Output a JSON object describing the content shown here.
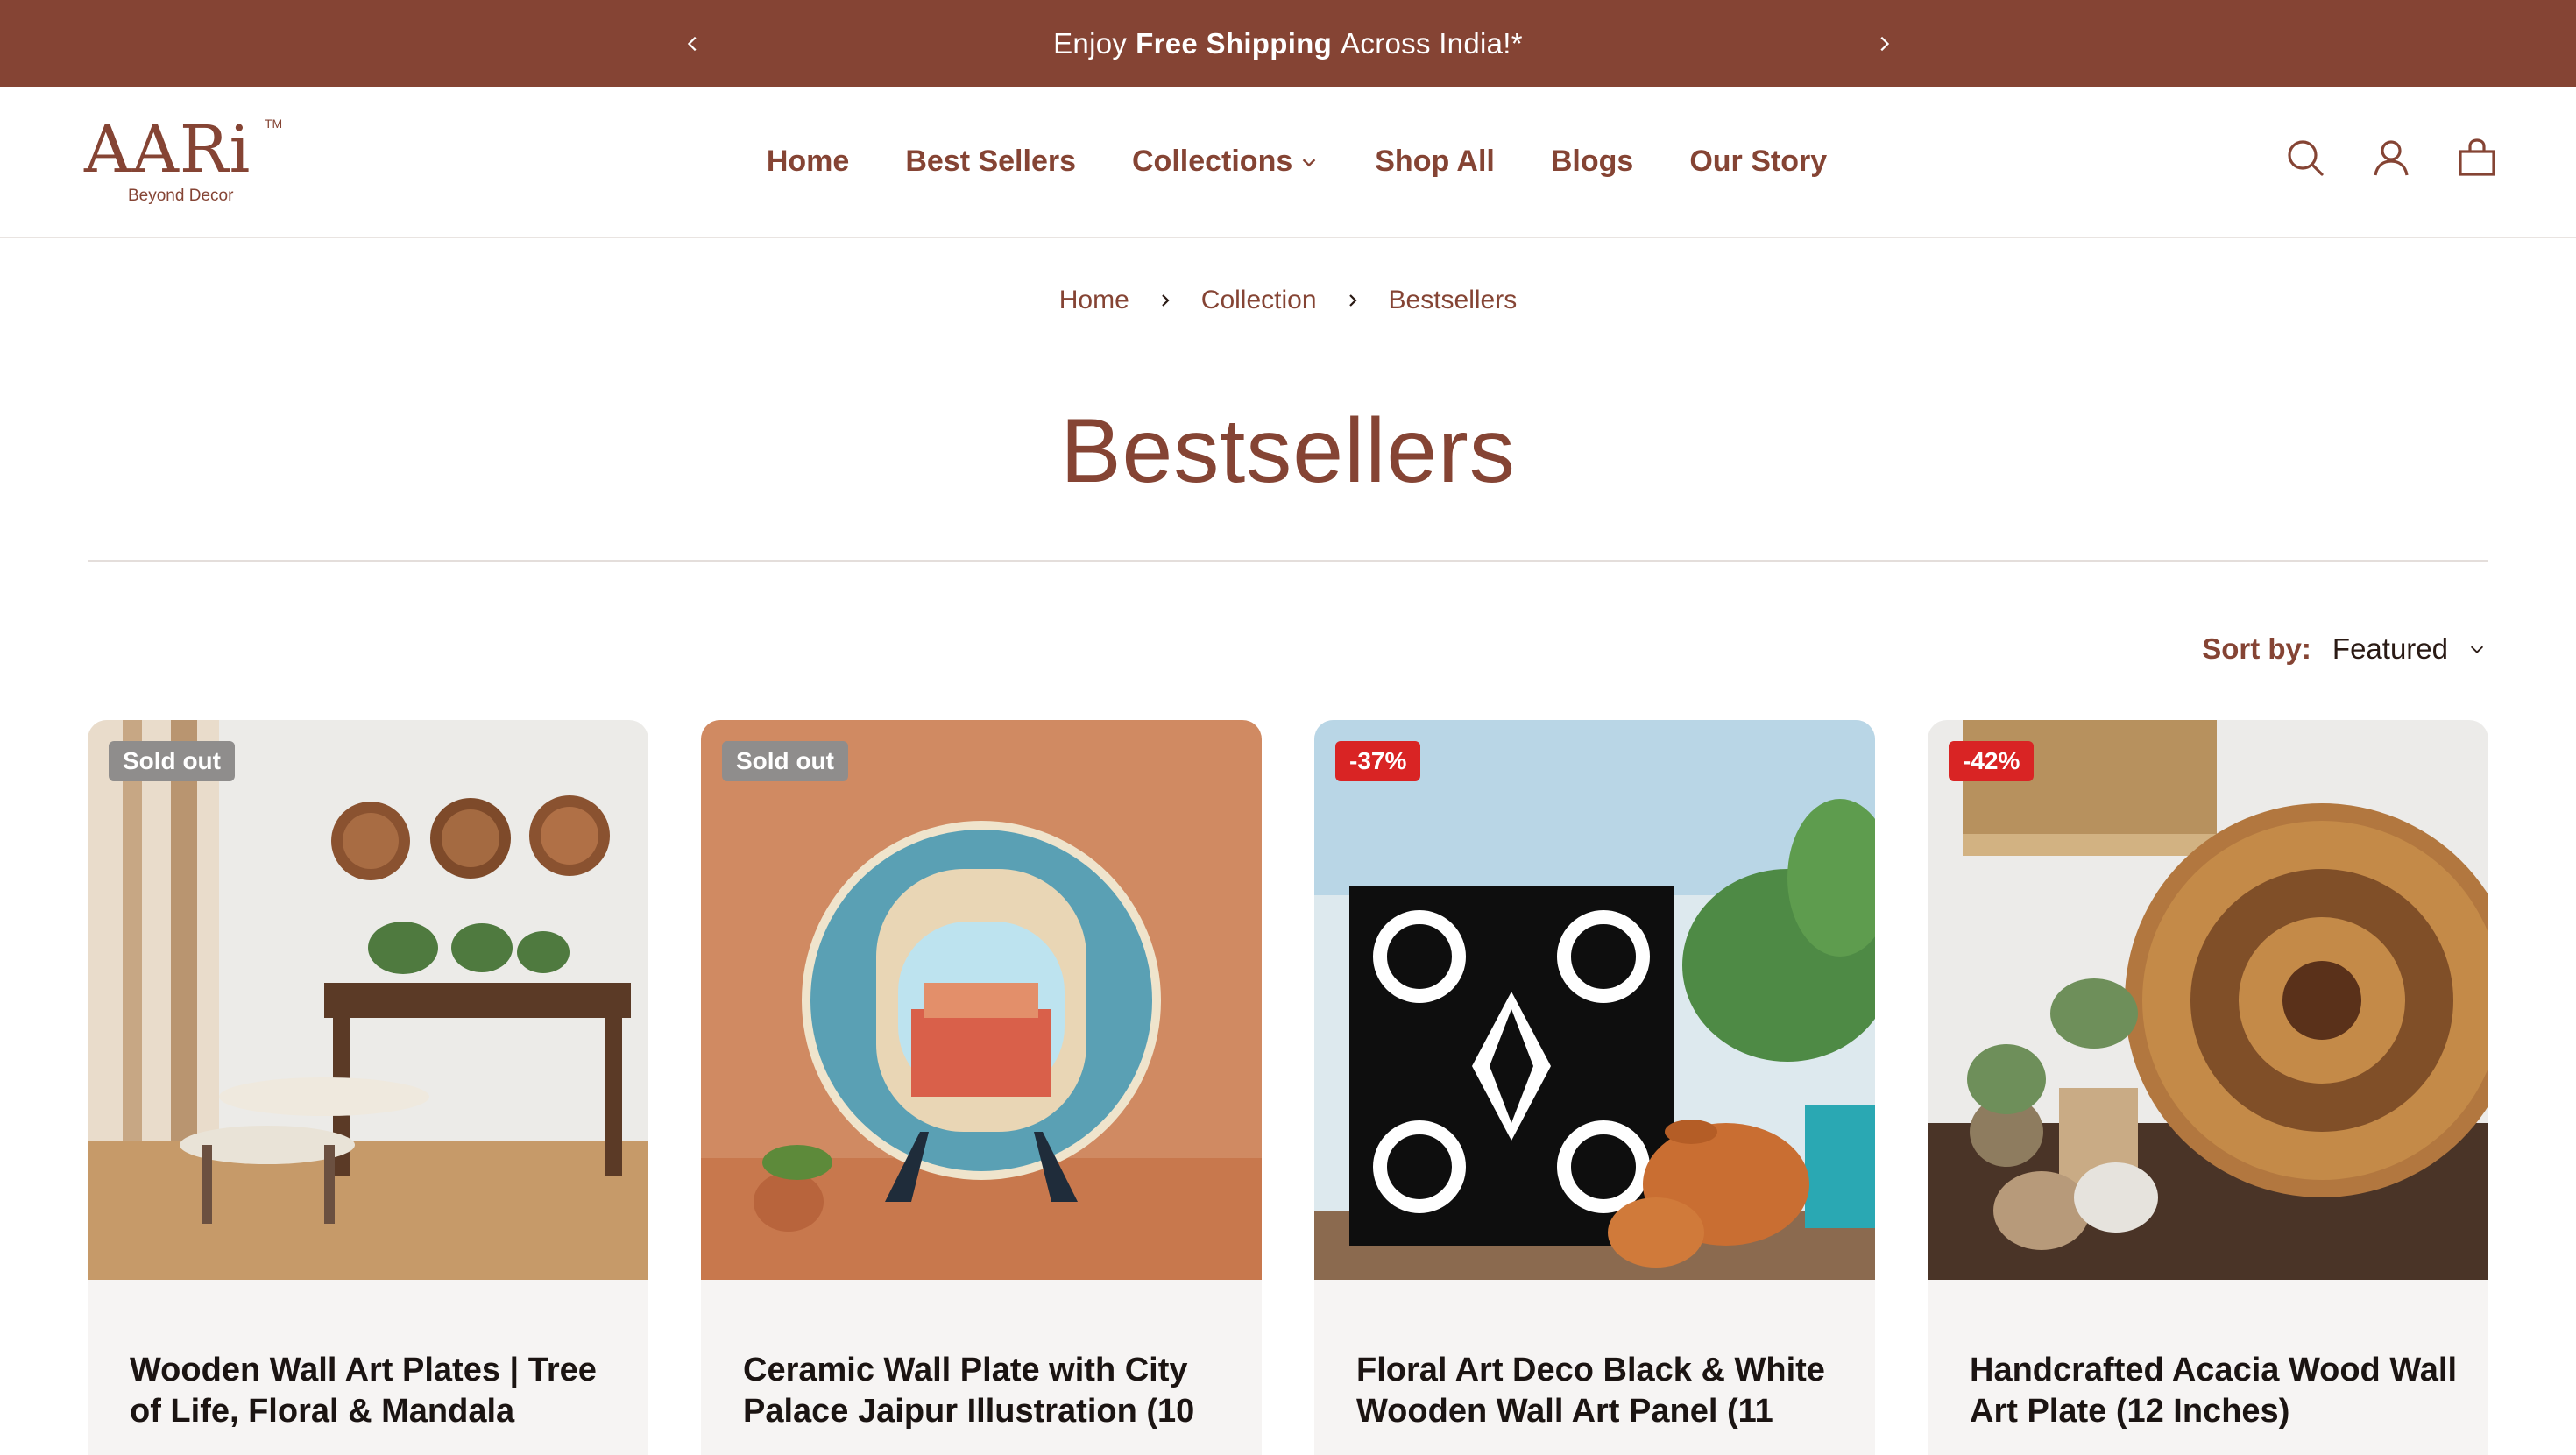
{
  "announcement": {
    "prefix": "Enjoy",
    "bold": "Free Shipping",
    "suffix": "Across India!*"
  },
  "brand": {
    "logo_text": "AARi",
    "trademark": "TM",
    "tagline": "Beyond Decor"
  },
  "nav": {
    "items": [
      "Home",
      "Best Sellers",
      "Collections",
      "Shop All",
      "Blogs",
      "Our Story"
    ]
  },
  "header_icons": [
    "search-icon",
    "account-icon",
    "cart-icon"
  ],
  "breadcrumb": [
    "Home",
    "Collection",
    "Bestsellers"
  ],
  "page": {
    "title": "Bestsellers"
  },
  "sort": {
    "label": "Sort by:",
    "value": "Featured"
  },
  "products": [
    {
      "badge": "Sold out",
      "badge_type": "sold",
      "name": "Wooden Wall Art Plates | Tree of Life, Floral & Mandala"
    },
    {
      "badge": "Sold out",
      "badge_type": "sold",
      "name": "Ceramic Wall Plate with City Palace Jaipur Illustration (10"
    },
    {
      "badge": "-37%",
      "badge_type": "sale",
      "name": "Floral Art Deco Black & White Wooden Wall Art Panel (11"
    },
    {
      "badge": "-42%",
      "badge_type": "sale",
      "name": "Handcrafted Acacia Wood Wall Art Plate (12 Inches)"
    }
  ],
  "colors": {
    "brand": "#854434",
    "sold_badge": "#8f8d8c",
    "sale_badge": "#d92424"
  }
}
